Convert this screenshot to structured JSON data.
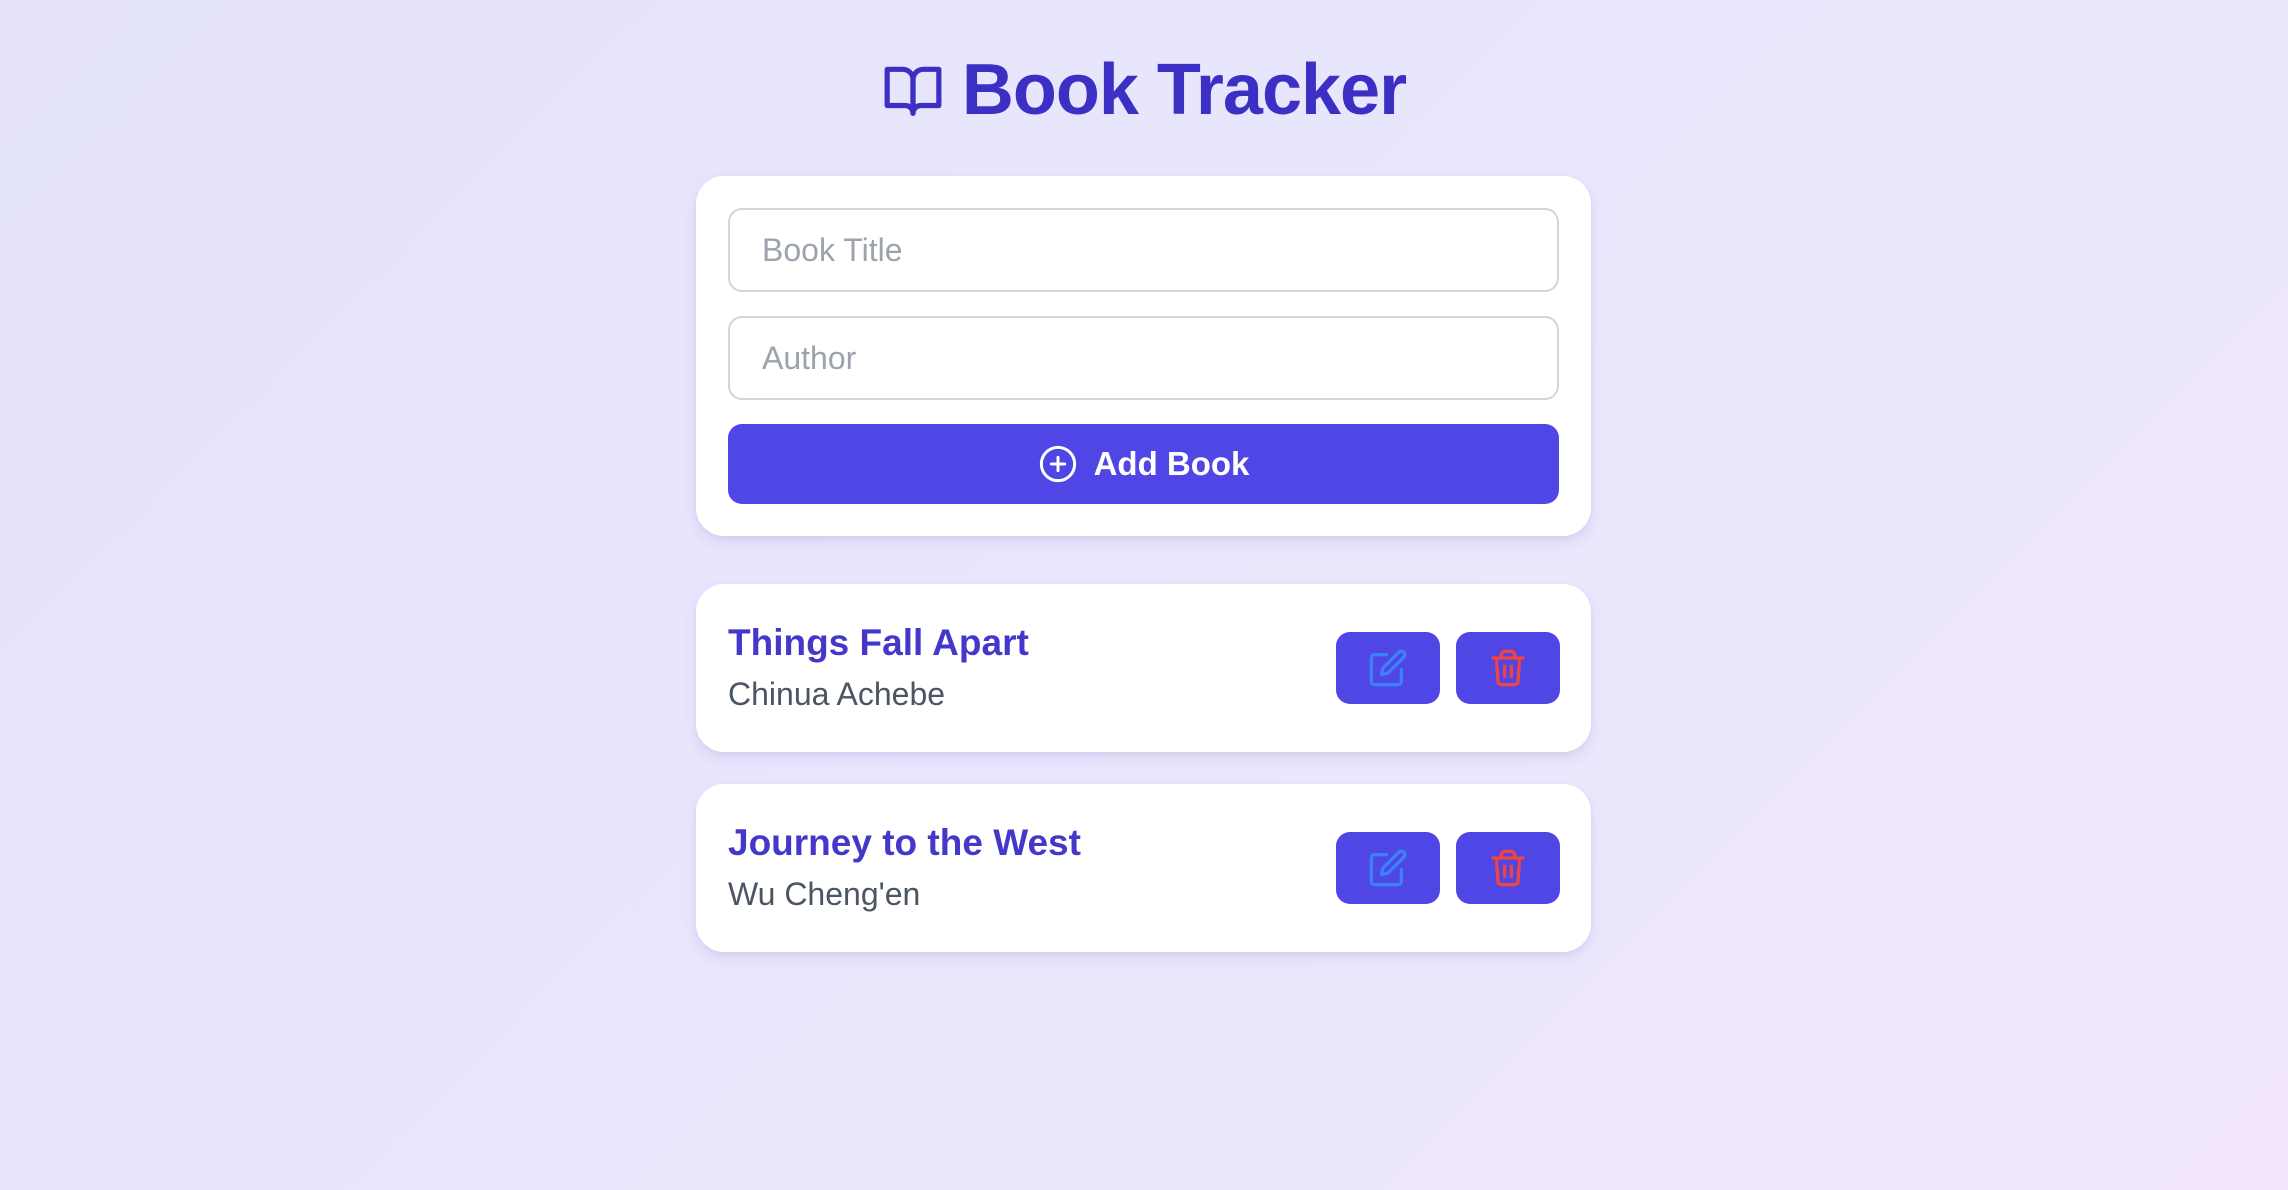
{
  "header": {
    "title": "Book Tracker",
    "icon": "open-book-icon"
  },
  "form": {
    "title_placeholder": "Book Title",
    "title_value": "",
    "author_placeholder": "Author",
    "author_value": "",
    "add_button_label": "Add Book",
    "add_button_icon": "plus-circle-icon"
  },
  "books": [
    {
      "title": "Things Fall Apart",
      "author": "Chinua Achebe"
    },
    {
      "title": "Journey to the West",
      "author": "Wu Cheng'en"
    }
  ],
  "actions": {
    "edit_icon": "edit-icon",
    "delete_icon": "trash-icon"
  },
  "colors": {
    "accent": "#4f46e5",
    "heading": "#3b2fc4",
    "book_title": "#4338ca",
    "edit_icon": "#3b82f6",
    "delete_icon": "#ef4444"
  }
}
